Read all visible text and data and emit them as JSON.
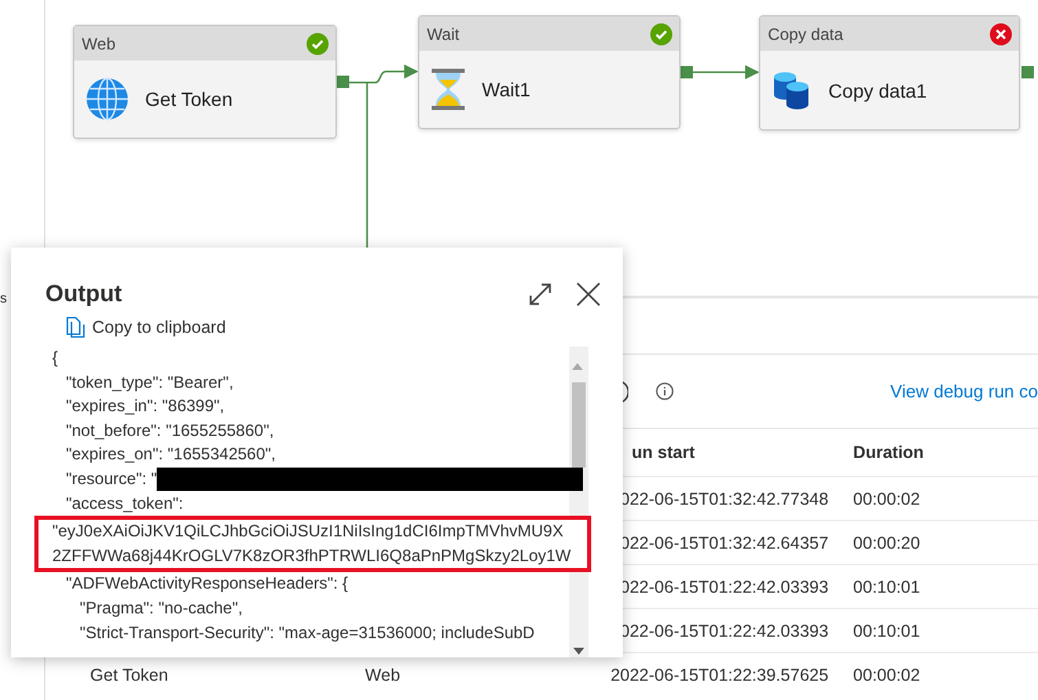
{
  "left_rail": {
    "label": "s"
  },
  "pipeline": {
    "activities": [
      {
        "type_label": "Web",
        "name": "Get Token",
        "kind": "web",
        "succeeded": true
      },
      {
        "type_label": "Wait",
        "name": "Wait1",
        "kind": "wait",
        "succeeded": true
      },
      {
        "type_label": "Copy data",
        "name": "Copy data1",
        "kind": "copy",
        "succeeded": false
      }
    ]
  },
  "debug_panel": {
    "link": "View debug run co",
    "table": {
      "columns": [
        "un start",
        "Duration"
      ],
      "rows": [
        {
          "run_start": "022-06-15T01:32:42.77348",
          "duration": "00:00:02"
        },
        {
          "run_start": "022-06-15T01:32:42.64357",
          "duration": "00:00:20"
        },
        {
          "run_start": "022-06-15T01:22:42.03393",
          "duration": "00:10:01"
        },
        {
          "run_start": "022-06-15T01:22:42.03393",
          "duration": "00:10:01"
        },
        {
          "activity_name": "Get Token",
          "type": "Web",
          "run_start": "2022-06-15T01:22:39.57625",
          "duration": "00:00:02"
        }
      ]
    }
  },
  "output_dialog": {
    "title": "Output",
    "copy_label": "Copy to clipboard",
    "lines": [
      {
        "text": "{",
        "redacted": false,
        "highlighted": false
      },
      {
        "text": "   \"token_type\": \"Bearer\",",
        "redacted": false,
        "highlighted": false
      },
      {
        "text": "   \"expires_in\": \"86399\",",
        "redacted": false,
        "highlighted": false
      },
      {
        "text": "   \"not_before\": \"1655255860\",",
        "redacted": false,
        "highlighted": false
      },
      {
        "text": "   \"expires_on\": \"1655342560\",",
        "redacted": false,
        "highlighted": false
      },
      {
        "text": "   \"resource\": \"",
        "redacted": true,
        "highlighted": false
      },
      {
        "text": "   \"access_token\":",
        "redacted": false,
        "highlighted": false
      },
      {
        "text": "\"eyJ0eXAiOiJKV1QiLCJhbGciOiJSUzI1NiIsIng1dCI6ImpTMVhvMU9X",
        "redacted": false,
        "highlighted": true
      },
      {
        "text": "2ZFFWWa68j44KrOGLV7K8zOR3fhPTRWLI6Q8aPnPMgSkzy2Loy1W",
        "redacted": false,
        "highlighted": true
      },
      {
        "text": "   \"ADFWebActivityResponseHeaders\": {",
        "redacted": false,
        "highlighted": false
      },
      {
        "text": "      \"Pragma\": \"no-cache\",",
        "redacted": false,
        "highlighted": false
      },
      {
        "text": "      \"Strict-Transport-Security\": \"max-age=31536000; includeSubD",
        "redacted": false,
        "highlighted": false
      }
    ]
  }
}
